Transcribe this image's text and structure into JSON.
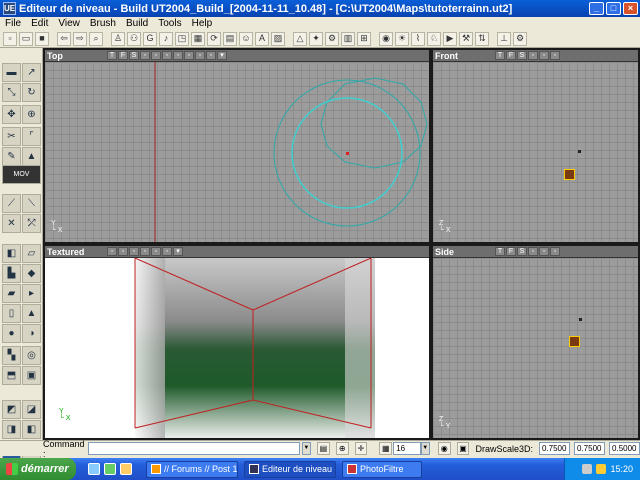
{
  "window": {
    "title": "Editeur de niveau - Build UT2004_Build_[2004-11-11_10.48] - [C:\\UT2004\\Maps\\tutoterrainn.ut2]",
    "icon_text": "UE"
  },
  "menu": [
    "File",
    "Edit",
    "View",
    "Brush",
    "Build",
    "Tools",
    "Help"
  ],
  "viewports": {
    "top": {
      "title": "Top",
      "axes_x": "X",
      "axes_y": "Y"
    },
    "front": {
      "title": "Front",
      "axes_x": "X",
      "axes_y": "Z"
    },
    "textured": {
      "title": "Textured",
      "axes_x": "X",
      "axes_y": "Y"
    },
    "side": {
      "title": "Side",
      "axes_x": "Y",
      "axes_y": "Z"
    },
    "mode_labels": [
      "T",
      "F",
      "S"
    ]
  },
  "statusbar": {
    "command_label": "Command :",
    "grid_value": "16",
    "drawscale_label": "DrawScale3D:",
    "scale_x": "0.7500",
    "scale_y": "0.7500",
    "scale_z": "0.5000"
  },
  "taskbar": {
    "start_label": "démarrer",
    "tasks": [
      "// Forums // Post 101...",
      "Editeur de niveau - B...",
      "PhotoFiltre"
    ],
    "clock": "15:20"
  },
  "icons": {
    "toolbar": [
      "new-file-icon",
      "open-icon",
      "save-icon",
      "undo-icon",
      "redo-icon",
      "find-icon",
      "actor-browser-icon",
      "group-browser-icon",
      "music-browser-icon",
      "sound-browser-icon",
      "texture-browser-icon",
      "mesh-browser-icon",
      "prefab-browser-icon",
      "static-mesh-browser-icon",
      "animation-browser-icon",
      "code-icon",
      "build-geometry-icon",
      "build-lighting-icon",
      "build-paths-icon",
      "build-all-icon",
      "play-icon"
    ],
    "colors": {
      "grid": "#9c9c9c",
      "circle": "#2fb8b8",
      "selection_red": "#c02020"
    }
  }
}
